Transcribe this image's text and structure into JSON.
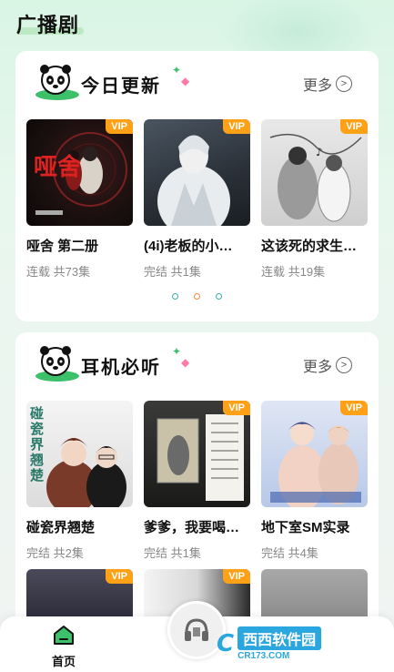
{
  "page": {
    "title": "广播剧"
  },
  "sections": [
    {
      "title": "今日更新",
      "more": "更多",
      "items": [
        {
          "title": "哑舍 第二册",
          "sub": "连载 共73集",
          "vip": "VIP",
          "cover_text": "哑舍"
        },
        {
          "title": "(4i)老板的小…",
          "sub": "完结 共1集",
          "vip": "VIP"
        },
        {
          "title": "这该死的求生…",
          "sub": "连载 共19集",
          "vip": "VIP"
        }
      ]
    },
    {
      "title": "耳机必听",
      "more": "更多",
      "items": [
        {
          "title": "碰瓷界翘楚",
          "sub": "完结 共2集",
          "vip": "",
          "cover_text": "碰瓷界翘楚"
        },
        {
          "title": "爹爹，我要喝…",
          "sub": "完结 共1集",
          "vip": "VIP"
        },
        {
          "title": "地下室SM实录",
          "sub": "完结 共4集",
          "vip": "VIP"
        }
      ]
    }
  ],
  "row3": [
    {
      "vip": "VIP"
    },
    {
      "vip": "VIP"
    },
    {
      "vip": ""
    }
  ],
  "carousel_dots": {
    "count": 3,
    "active_index": 1
  },
  "bottom_nav": {
    "home_label": "首页"
  },
  "watermark": {
    "logo": "C",
    "main": "西西软件园",
    "url": "CR173.COM"
  },
  "colors": {
    "vip": "#ffa116",
    "accent_green": "#3cc06a",
    "dot_active": "#ff8a3d",
    "dot_teal": "#37b3b0"
  }
}
